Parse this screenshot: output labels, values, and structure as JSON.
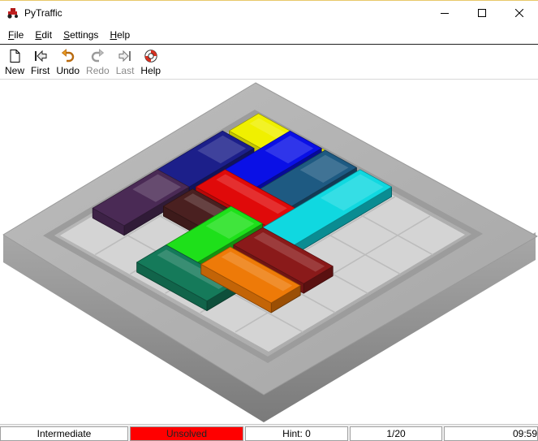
{
  "window": {
    "title": "PyTraffic"
  },
  "menu": {
    "items": [
      {
        "first": "F",
        "rest": "ile"
      },
      {
        "first": "E",
        "rest": "dit"
      },
      {
        "first": "S",
        "rest": "ettings"
      },
      {
        "first": "H",
        "rest": "elp"
      }
    ]
  },
  "toolbar": {
    "new": "New",
    "first": "First",
    "undo": "Undo",
    "redo": "Redo",
    "last": "Last",
    "help": "Help"
  },
  "status": {
    "level": "Intermediate",
    "state": "Unsolved",
    "hint": "Hint: 0",
    "moves": "1/20",
    "time": "09:59"
  },
  "colors": {
    "status_unsolved": "#ff0000",
    "yellow": "#f0f000",
    "navy": "#1c1f8a",
    "blue": "#0a10e6",
    "purple": "#4a2a55",
    "red": "#e00a0a",
    "steel-blue": "#1e5a82",
    "brown": "#4a2020",
    "green": "#1ee01a",
    "cyan": "#10d8e0",
    "teal": "#157a5a",
    "maroon": "#8a1a1a",
    "orange": "#ee7a08"
  }
}
